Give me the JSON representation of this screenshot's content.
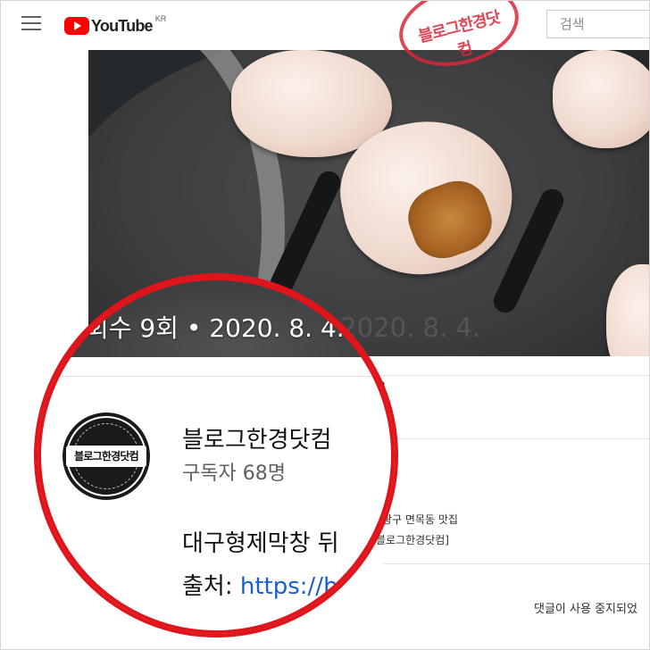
{
  "header": {
    "logo_text": "YouTube",
    "region": "KR",
    "search_placeholder": "검색",
    "watermark": "블로그한경닷컴"
  },
  "video": {
    "meta": "회수 9회 • 2020. 8. 4."
  },
  "page": {
    "kr_fragment": "R",
    "desc_line1": "광구 면목동 맛집",
    "desc_line2": "블로그한경닷컴]",
    "comments_disabled": "댓글이 사용 중지되었"
  },
  "magnifier": {
    "meta": "회수 9회 • 2020. 8. 4.",
    "channel": {
      "avatar_text": "블로그한경닷컴",
      "name": "블로그한경닷컴",
      "subscribers": "구독자 68명"
    },
    "description_line1": "대구형제막창 뒤",
    "description_prefix": "출처: ",
    "description_link": "https://b"
  },
  "colors": {
    "youtube_red": "#ff0000",
    "magnifier_ring": "#e0141b",
    "link": "#1a5fd0"
  }
}
